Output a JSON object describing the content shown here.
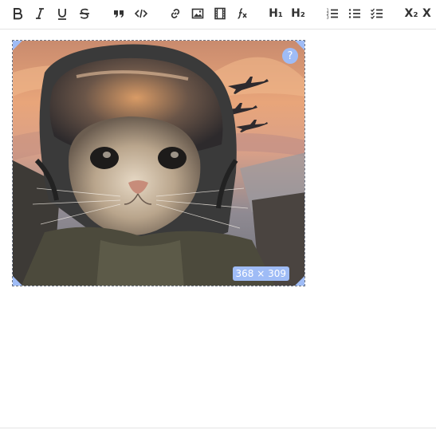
{
  "toolbar": {
    "bold_icon": "bold-icon",
    "italic_icon": "italic-icon",
    "underline_icon": "underline-icon",
    "strike_icon": "strikethrough-icon",
    "quote_icon": "quote-icon",
    "code_icon": "code-icon",
    "link_icon": "link-icon",
    "image_icon": "image-icon",
    "video_icon": "video-icon",
    "formula_icon": "formula-icon",
    "h1_label": "H₁",
    "h2_label": "H₂",
    "ordered_list_icon": "ordered-list-icon",
    "bullet_list_icon": "bullet-list-icon",
    "check_list_icon": "check-list-icon",
    "subscript_label": "X₂",
    "clear_label": "X"
  },
  "image": {
    "help_label": "?",
    "size_label": "368 × 309"
  },
  "colors": {
    "accent": "#9fbcf6",
    "icon": "#333333",
    "border": "#e4e4e4"
  }
}
